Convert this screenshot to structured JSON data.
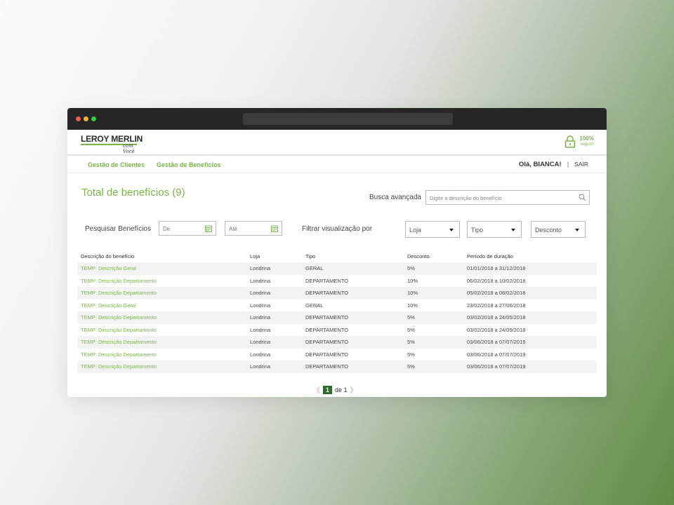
{
  "brand": {
    "name": "LEROY MERLIN",
    "sub": "com Você",
    "secure_main": "100%",
    "secure_sub": "seguro"
  },
  "nav": {
    "items": [
      "Gestão de Clientes",
      "Gestão de Benefícios"
    ],
    "greeting": "Olá, BIANCA!",
    "separator": "|",
    "logout": "SAIR"
  },
  "page": {
    "title": "Total de benefícios (9)"
  },
  "search": {
    "label": "Busca avançada",
    "placeholder": "Digite a descrição do benefício"
  },
  "filters": {
    "search_label": "Pesquisar Benefícios",
    "from_placeholder": "De",
    "to_placeholder": "Até",
    "view_label": "Filtrar visualização por",
    "selects": [
      "Loja",
      "Tipo",
      "Desconto"
    ]
  },
  "table": {
    "headers": [
      "Descrição do benefício",
      "Loja",
      "Tipo",
      "Desconto",
      "Período de duração"
    ],
    "rows": [
      [
        "TEMP: Descrição Geral",
        "Londrina",
        "GERAL",
        "5%",
        "01/01/2018 a 31/12/2018"
      ],
      [
        "TEMP: Descrição Departamento",
        "Londrina",
        "DEPARTAMENTO",
        "10%",
        "06/02/2018 a 10/02/2018"
      ],
      [
        "TEMP: Descrição Departamento",
        "Londrina",
        "DEPARTAMENTO",
        "10%",
        "05/02/2018 a 08/02/2018"
      ],
      [
        "TEMP: Descrição Geral",
        "Londrina",
        "GERAL",
        "10%",
        "23/02/2018 a 27/06/2018"
      ],
      [
        "TEMP: Descrição Departamento",
        "Londrina",
        "DEPARTAMENTO",
        "5%",
        "03/02/2018 a 24/05/2018"
      ],
      [
        "TEMP: Descrição Departamento",
        "Londrina",
        "DEPARTAMENTO",
        "5%",
        "03/02/2018 a 24/05/2018"
      ],
      [
        "TEMP: Descrição Departamento",
        "Londrina",
        "DEPARTAMENTO",
        "5%",
        "03/06/2018 a 07/07/2019"
      ],
      [
        "TEMP: Descrição Departamento",
        "Londrina",
        "DEPARTAMENTO",
        "5%",
        "03/06/2018 a 07/07/2019"
      ],
      [
        "TEMP: Descrição Departamento",
        "Londrina",
        "DEPARTAMENTO",
        "5%",
        "03/06/2018 a 07/07/2019"
      ]
    ]
  },
  "pagination": {
    "prev": "《",
    "current": "1",
    "of_text": "de 1",
    "next": "》"
  },
  "icons": {
    "lock": "lock-icon",
    "search": "search-icon",
    "calendar": "calendar-icon"
  },
  "colors": {
    "accent": "#7ab648",
    "pager_active": "#2f6b2a",
    "titlebar": "#262626"
  }
}
